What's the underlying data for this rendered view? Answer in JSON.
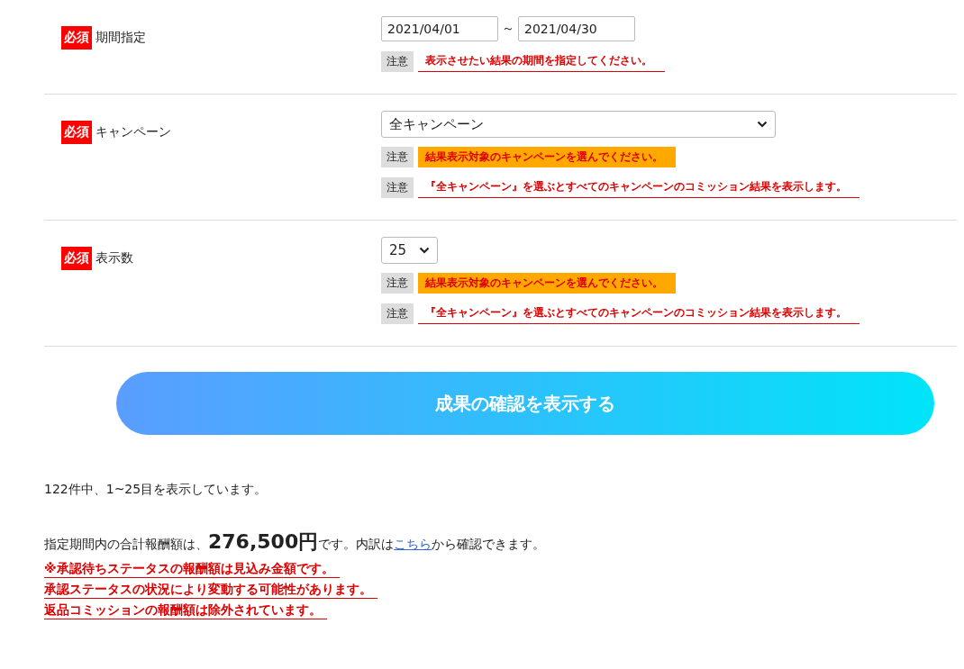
{
  "form_rows": [
    {
      "required_badge": "必須",
      "label": "期間指定",
      "control": {
        "kind": "date_range",
        "start": "2021/04/01",
        "separator": "～",
        "end": "2021/04/30"
      },
      "notes": [
        {
          "tag": "注意",
          "text": "表示させたい結果の期間を指定してください。",
          "kind": "underline"
        }
      ]
    },
    {
      "required_badge": "必須",
      "label": "キャンペーン",
      "control": {
        "kind": "select",
        "value": "全キャンペーン"
      },
      "notes": [
        {
          "tag": "注意",
          "text": "結果表示対象のキャンペーンを選んでください。",
          "kind": "highlight"
        },
        {
          "tag": "注意",
          "text": "『全キャンペーン』を選ぶとすべてのキャンペーンのコミッション結果を表示します。",
          "kind": "underline"
        }
      ]
    },
    {
      "required_badge": "必須",
      "label": "表示数",
      "control": {
        "kind": "compact_select",
        "value": "25"
      },
      "notes": [
        {
          "tag": "注意",
          "text": "結果表示対象のキャンペーンを選んでください。",
          "kind": "highlight"
        },
        {
          "tag": "注意",
          "text": "『全キャンペーン』を選ぶとすべてのキャンペーンのコミッション結果を表示します。",
          "kind": "underline"
        }
      ]
    }
  ],
  "submit_button": "成果の確認を表示する",
  "result_count": "122件中、1~25目を表示しています。",
  "summary": {
    "before": "指定期間内の合計報酬額は、**276,500円**です。内訳は",
    "link": "こちら",
    "after": "から確認できます。"
  },
  "warnings": [
    "※承認待ちステータスの報酬額は見込み金額です。",
    "承認ステータスの状況により変動する可能性があります。",
    "返品コミッションの報酬額は除外されています。"
  ]
}
